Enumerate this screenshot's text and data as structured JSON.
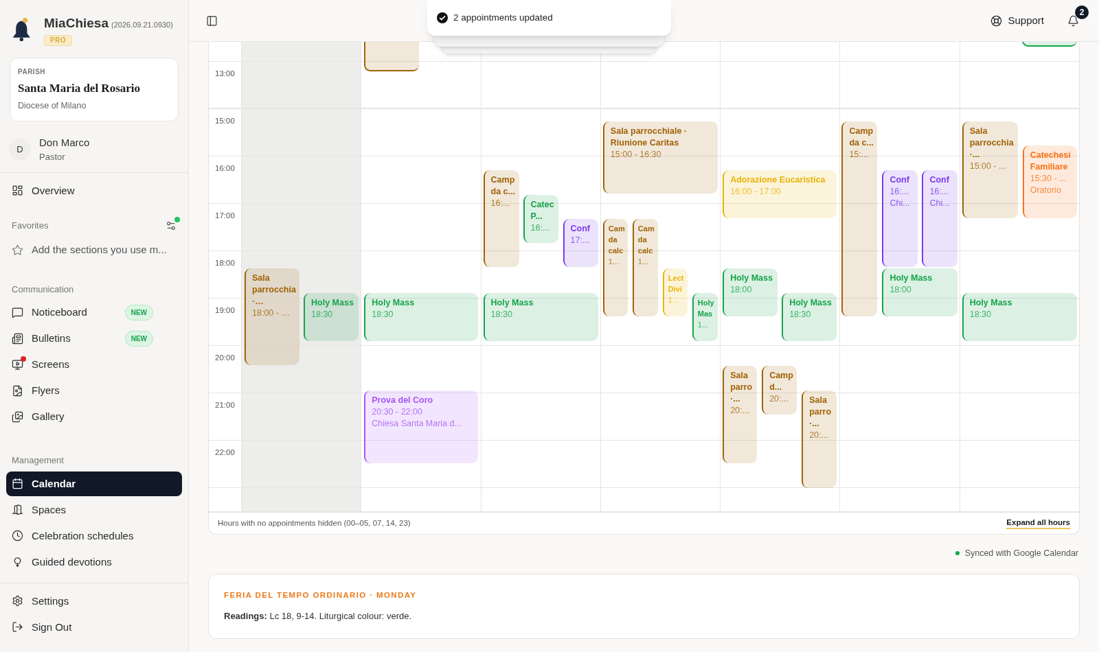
{
  "sidebar": {
    "brand": {
      "name": "MiaChiesa",
      "version": "(2026.09.21.0930)",
      "badge": "PRO"
    },
    "parish": {
      "label": "PARISH",
      "name": "Santa Maria del Rosario",
      "diocese": "Diocese of Milano"
    },
    "user": {
      "initial": "D",
      "name": "Don Marco",
      "role": "Pastor"
    },
    "nav_top": [
      {
        "label": "Overview",
        "selected": false
      }
    ],
    "favorites": {
      "title": "Favorites",
      "has_update": true,
      "hint": "Add the sections you use m..."
    },
    "sections": [
      {
        "title": "Communication",
        "items": [
          {
            "label": "Noticeboard",
            "selected": false,
            "alert": false,
            "badge": "NEW"
          },
          {
            "label": "Bulletins",
            "selected": false,
            "alert": false,
            "badge": "NEW"
          },
          {
            "label": "Screens",
            "selected": false,
            "alert": true
          },
          {
            "label": "Flyers",
            "selected": false,
            "alert": false
          },
          {
            "label": "Gallery",
            "selected": false,
            "alert": false
          }
        ]
      },
      {
        "title": "Management",
        "items": [
          {
            "label": "Calendar",
            "selected": true,
            "alert": false
          },
          {
            "label": "Spaces",
            "selected": false,
            "alert": false
          },
          {
            "label": "Celebration schedules",
            "selected": false,
            "alert": false
          },
          {
            "label": "Guided devotions",
            "selected": false,
            "alert": false
          }
        ]
      }
    ],
    "nav_bottom": [
      {
        "label": "Settings",
        "selected": false
      },
      {
        "label": "Sign Out",
        "selected": false
      }
    ]
  },
  "header": {
    "toast": "2 appointments updated",
    "support": "Support",
    "notifications": "2"
  },
  "calendar": {
    "time_labels": [
      "13:00",
      "15:00",
      "16:00",
      "17:00",
      "18:00",
      "19:00",
      "20:00",
      "21:00",
      "22:00"
    ],
    "days": [
      {
        "shaded": true,
        "events": [
          {
            "title": "Sala parrocchia ·…",
            "time": "18:00 - …",
            "color": "#a16207"
          },
          {
            "title": "Holy Mass",
            "time": "18:30",
            "color": "#16a34a"
          }
        ]
      },
      {
        "shaded": false,
        "events": [
          {
            "color": "#a16207"
          },
          {
            "title": "Holy Mass",
            "time": "18:30",
            "color": "#16a34a"
          },
          {
            "title": "Prova del Coro",
            "time": "20:30 - 22:00",
            "place": "Chiesa Santa Maria d...",
            "color": "#a855f7"
          }
        ]
      },
      {
        "shaded": false,
        "events": [
          {
            "title": "Camp da c...",
            "time": "16:...",
            "color": "#a16207"
          },
          {
            "title": "Catec P...",
            "time": "16:...",
            "color": "#16a34a"
          },
          {
            "title": "Conf",
            "time": "17:...",
            "color": "#7c3aed"
          },
          {
            "title": "Holy Mass",
            "time": "18:30",
            "color": "#16a34a"
          }
        ]
      },
      {
        "shaded": false,
        "events": [
          {
            "title": "Sala parrocchiale · Riunione Caritas",
            "time": "15:00 - 16:30",
            "color": "#a16207"
          },
          {
            "title": "Cam da calc",
            "time": "1...",
            "color": "#a16207"
          },
          {
            "title": "Cam da calc",
            "time": "1...",
            "color": "#a16207"
          },
          {
            "title": "Lect Divi",
            "time": "1...",
            "color": "#eab308"
          },
          {
            "title": "Holy Mas",
            "time": "1...",
            "color": "#16a34a"
          }
        ]
      },
      {
        "shaded": false,
        "events": [
          {
            "title": "Adorazione Eucaristica",
            "time": "16:00 - 17:00",
            "color": "#eab308"
          },
          {
            "title": "Holy Mass",
            "time": "18:00",
            "color": "#16a34a"
          },
          {
            "title": "Holy Mass",
            "time": "18:30",
            "color": "#16a34a"
          },
          {
            "title": "Sala parro ·...",
            "time": "20:...",
            "color": "#a16207"
          },
          {
            "title": "Camp d...",
            "time": "20:...",
            "color": "#a16207"
          },
          {
            "title": "Sala parro ·...",
            "time": "20:...",
            "color": "#a16207"
          }
        ]
      },
      {
        "shaded": false,
        "events": [
          {
            "title": "Camp da c...",
            "time": "15:...",
            "color": "#a16207"
          },
          {
            "title": "Conf",
            "time": "16:...",
            "place": "Chi...",
            "color": "#7c3aed"
          },
          {
            "title": "Conf",
            "time": "16:...",
            "place": "Chi...",
            "color": "#7c3aed"
          },
          {
            "title": "Holy Mass",
            "time": "18:00",
            "color": "#16a34a"
          }
        ]
      },
      {
        "shaded": false,
        "events": [
          {
            "color": "#16a34a"
          },
          {
            "title": "Sala parrocchia ·...",
            "time": "15:00 - ...",
            "color": "#a16207"
          },
          {
            "title": "Catechesi Familiare",
            "time": "15:30 - ...",
            "place": "Oratorio",
            "color": "#f97316"
          },
          {
            "title": "Holy Mass",
            "time": "18:30",
            "color": "#16a34a"
          }
        ]
      }
    ],
    "footer": {
      "note": "Hours with no appointments hidden (00–05, 07, 14, 23)",
      "action": "Expand all hours"
    }
  },
  "sync_status": "Synced with Google Calendar",
  "liturgy": {
    "title": "FERIA DEL TEMPO ORDINARIO · MONDAY",
    "readings": "**Readings:** Lc 18, 9-14. Liturgical colour: verde."
  }
}
